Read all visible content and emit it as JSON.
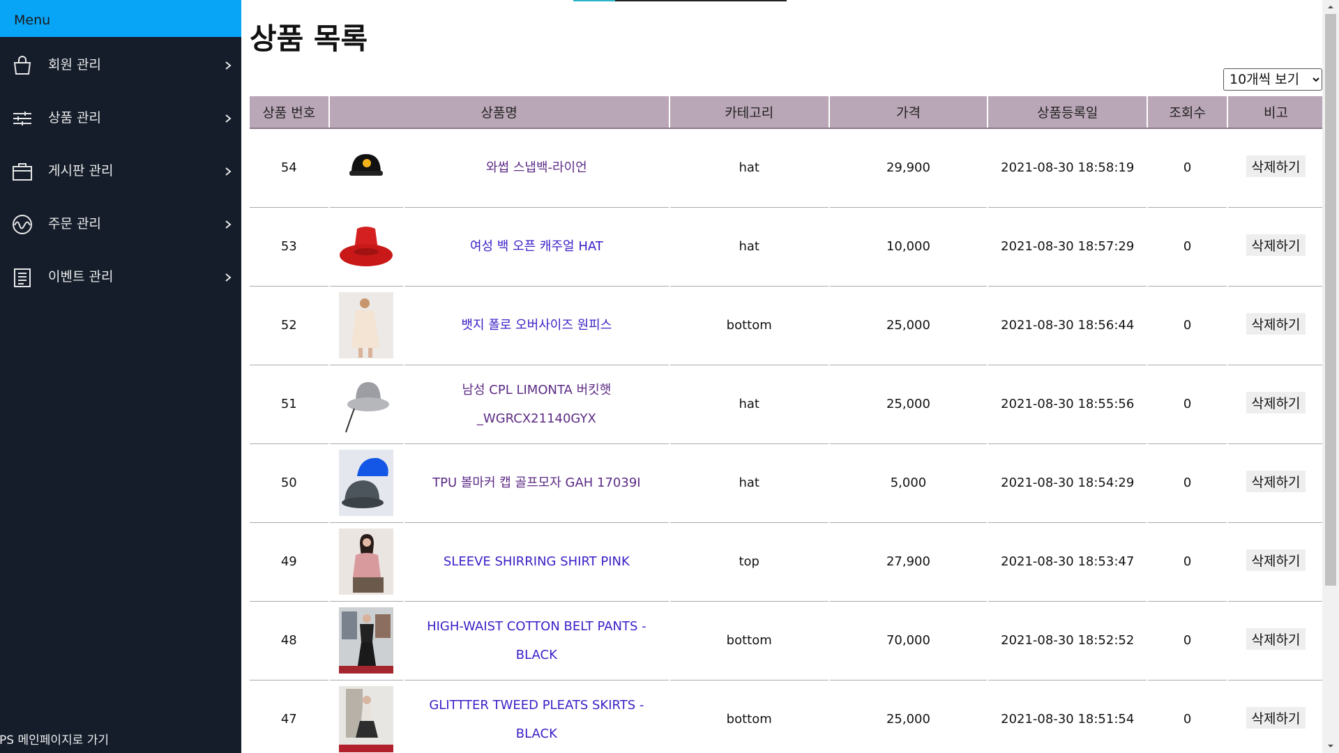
{
  "sidebar": {
    "header": "Menu",
    "items": [
      {
        "label": "회원 관리",
        "icon": "shopping-bag-icon"
      },
      {
        "label": "상품 관리",
        "icon": "sliders-icon"
      },
      {
        "label": "게시판 관리",
        "icon": "briefcase-icon"
      },
      {
        "label": "주문 관리",
        "icon": "activity-icon"
      },
      {
        "label": "이벤트 관리",
        "icon": "list-document-icon"
      }
    ],
    "footer": "JPS 메인페이지로 가기"
  },
  "main": {
    "title": "상품 목록",
    "page_size": {
      "selected": "10개씩 보기"
    },
    "columns": [
      "상품 번호",
      "상품명",
      "카테고리",
      "가격",
      "상품등록일",
      "조회수",
      "비고"
    ],
    "delete_label": "삭제하기",
    "rows": [
      {
        "no": "54",
        "name": "와썹 스냅백-라이언",
        "category": "hat",
        "price": "29,900",
        "date": "2021-08-30 18:58:19",
        "views": "0",
        "thumb": "black-cap-lion"
      },
      {
        "no": "53",
        "name": "여성 백 오픈 캐주얼 HAT",
        "category": "hat",
        "price": "10,000",
        "date": "2021-08-30 18:57:29",
        "views": "0",
        "thumb": "red-bucket-hat"
      },
      {
        "no": "52",
        "name": "뱃지 폴로 오버사이즈 원피스",
        "category": "bottom",
        "price": "25,000",
        "date": "2021-08-30 18:56:44",
        "views": "0",
        "thumb": "beige-dress-model"
      },
      {
        "no": "51",
        "name": "남성 CPL LIMONTA 버킷햇 _WGRCX21140GYX",
        "category": "hat",
        "price": "25,000",
        "date": "2021-08-30 18:55:56",
        "views": "0",
        "thumb": "grey-bucket-hat"
      },
      {
        "no": "50",
        "name": "TPU 볼마커 캡 골프모자 GAH 17039I",
        "category": "hat",
        "price": "5,000",
        "date": "2021-08-30 18:54:29",
        "views": "0",
        "thumb": "blue-golf-caps"
      },
      {
        "no": "49",
        "name": "SLEEVE SHIRRING SHIRT PINK",
        "category": "top",
        "price": "27,900",
        "date": "2021-08-30 18:53:47",
        "views": "0",
        "thumb": "pink-shirt-model"
      },
      {
        "no": "48",
        "name": "HIGH-WAIST COTTON BELT PANTS - BLACK",
        "category": "bottom",
        "price": "70,000",
        "date": "2021-08-30 18:52:52",
        "views": "0",
        "thumb": "black-pants-model"
      },
      {
        "no": "47",
        "name": "GLITTTER TWEED PLEATS SKIRTS - BLACK",
        "category": "bottom",
        "price": "25,000",
        "date": "2021-08-30 18:51:54",
        "views": "0",
        "thumb": "tweed-skirt-model"
      }
    ]
  },
  "colors": {
    "sidebar_bg": "#151d2b",
    "menu_header": "#08a5f7",
    "table_header": "#b9a6b6",
    "link": "#3a1ec6",
    "link_visited": "#5b2a84"
  }
}
